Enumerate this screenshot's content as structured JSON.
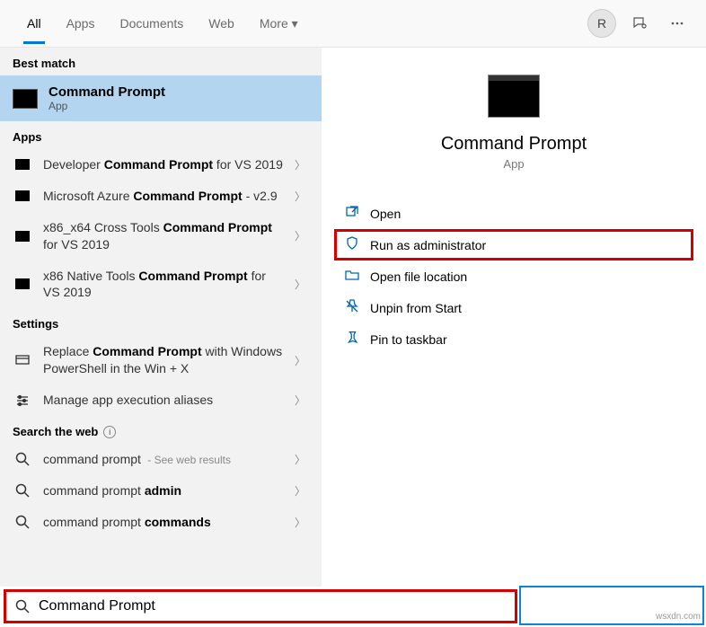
{
  "top": {
    "tabs": [
      "All",
      "Apps",
      "Documents",
      "Web",
      "More ▾"
    ],
    "avatar": "R"
  },
  "left": {
    "best_match_header": "Best match",
    "best_match": {
      "title": "Command Prompt",
      "sub": "App"
    },
    "apps_header": "Apps",
    "apps": [
      {
        "pre": "Developer ",
        "bold": "Command Prompt",
        "post": " for VS 2019"
      },
      {
        "pre": "Microsoft Azure ",
        "bold": "Command Prompt",
        "post": " - v2.9"
      },
      {
        "pre": "x86_x64 Cross Tools ",
        "bold": "Command Prompt",
        "post": " for VS 2019"
      },
      {
        "pre": "x86 Native Tools ",
        "bold": "Command Prompt",
        "post": " for VS 2019"
      }
    ],
    "settings_header": "Settings",
    "settings": [
      {
        "pre": "Replace ",
        "bold": "Command Prompt",
        "post": " with Windows PowerShell in the Win + X"
      },
      {
        "pre": "Manage app execution aliases",
        "bold": "",
        "post": ""
      }
    ],
    "web_header": "Search the web",
    "web": [
      {
        "text": "command prompt",
        "hint": " - See web results"
      },
      {
        "text": "command prompt ",
        "bold": "admin"
      },
      {
        "text": "command prompt ",
        "bold": "commands"
      }
    ]
  },
  "right": {
    "title": "Command Prompt",
    "sub": "App",
    "actions": [
      {
        "label": "Open",
        "icon": "open"
      },
      {
        "label": "Run as administrator",
        "icon": "admin",
        "highlight": true
      },
      {
        "label": "Open file location",
        "icon": "folder"
      },
      {
        "label": "Unpin from Start",
        "icon": "unpin"
      },
      {
        "label": "Pin to taskbar",
        "icon": "pin"
      }
    ]
  },
  "search": {
    "value": "Command Prompt"
  },
  "watermark": "wsxdn.com"
}
